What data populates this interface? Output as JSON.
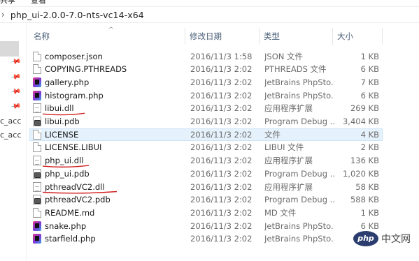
{
  "ribbon": {
    "tabs": [
      "共享",
      "查看"
    ]
  },
  "address": {
    "separator": "›",
    "path": "php_ui-2.0.0-7.0-nts-vc14-x64"
  },
  "nav": {
    "labels": [
      "c_acc",
      "c_acc"
    ]
  },
  "columns": {
    "name": "名称",
    "date": "修改日期",
    "type": "类型",
    "size": "大小",
    "sort_caret": "^"
  },
  "files": [
    {
      "name": "composer.json",
      "date": "2016/11/3 1:58",
      "type": "JSON 文件",
      "size": "1 KB",
      "icon": "document-icon"
    },
    {
      "name": "COPYING.PTHREADS",
      "date": "2016/11/3 2:02",
      "type": "PTHREADS 文件",
      "size": "6 KB",
      "icon": "document-icon"
    },
    {
      "name": "gallery.php",
      "date": "2016/11/3 2:02",
      "type": "JetBrains PhpSto...",
      "size": "7 KB",
      "icon": "phpstorm-icon"
    },
    {
      "name": "histogram.php",
      "date": "2016/11/3 2:02",
      "type": "JetBrains PhpSto...",
      "size": "6 KB",
      "icon": "phpstorm-icon"
    },
    {
      "name": "libui.dll",
      "date": "2016/11/3 2:02",
      "type": "应用程序扩展",
      "size": "269 KB",
      "icon": "dll-icon"
    },
    {
      "name": "libui.pdb",
      "date": "2016/11/3 2:02",
      "type": "Program Debug ...",
      "size": "3,404 KB",
      "icon": "pdb-icon"
    },
    {
      "name": "LICENSE",
      "date": "2016/11/3 2:02",
      "type": "文件",
      "size": "4 KB",
      "icon": "document-icon"
    },
    {
      "name": "LICENSE.LIBUI",
      "date": "2016/11/3 2:02",
      "type": "LIBUI 文件",
      "size": "2 KB",
      "icon": "document-icon"
    },
    {
      "name": "php_ui.dll",
      "date": "2016/11/3 2:02",
      "type": "应用程序扩展",
      "size": "136 KB",
      "icon": "dll-icon"
    },
    {
      "name": "php_ui.pdb",
      "date": "2016/11/3 2:02",
      "type": "Program Debug ...",
      "size": "1,020 KB",
      "icon": "pdb-icon"
    },
    {
      "name": "pthreadVC2.dll",
      "date": "2016/11/3 2:02",
      "type": "应用程序扩展",
      "size": "58 KB",
      "icon": "dll-icon"
    },
    {
      "name": "pthreadVC2.pdb",
      "date": "2016/11/3 2:02",
      "type": "Program Debug ...",
      "size": "588 KB",
      "icon": "pdb-icon"
    },
    {
      "name": "README.md",
      "date": "2016/11/3 2:02",
      "type": "MD 文件",
      "size": "1 KB",
      "icon": "document-icon"
    },
    {
      "name": "snake.php",
      "date": "2016/11/3 2:02",
      "type": "JetBrains PhpSto...",
      "size": "6 KB",
      "icon": "phpstorm-icon"
    },
    {
      "name": "starfield.php",
      "date": "2016/11/3 2:02",
      "type": "JetBrains PhpSto...",
      "size": "",
      "icon": "phpstorm-icon"
    }
  ],
  "selected_row": 6,
  "annotations": {
    "underline_color": "#d21f1f",
    "underlined_files": [
      "libui.dll",
      "php_ui.dll",
      "pthreadVC2.dll"
    ]
  },
  "watermark": {
    "logo_text": "php",
    "site_text": "中文网"
  },
  "colors": {
    "header_text": "#4c607a",
    "secondary_text": "#6b6b6b",
    "selection_bg": "#e5f1fb"
  }
}
